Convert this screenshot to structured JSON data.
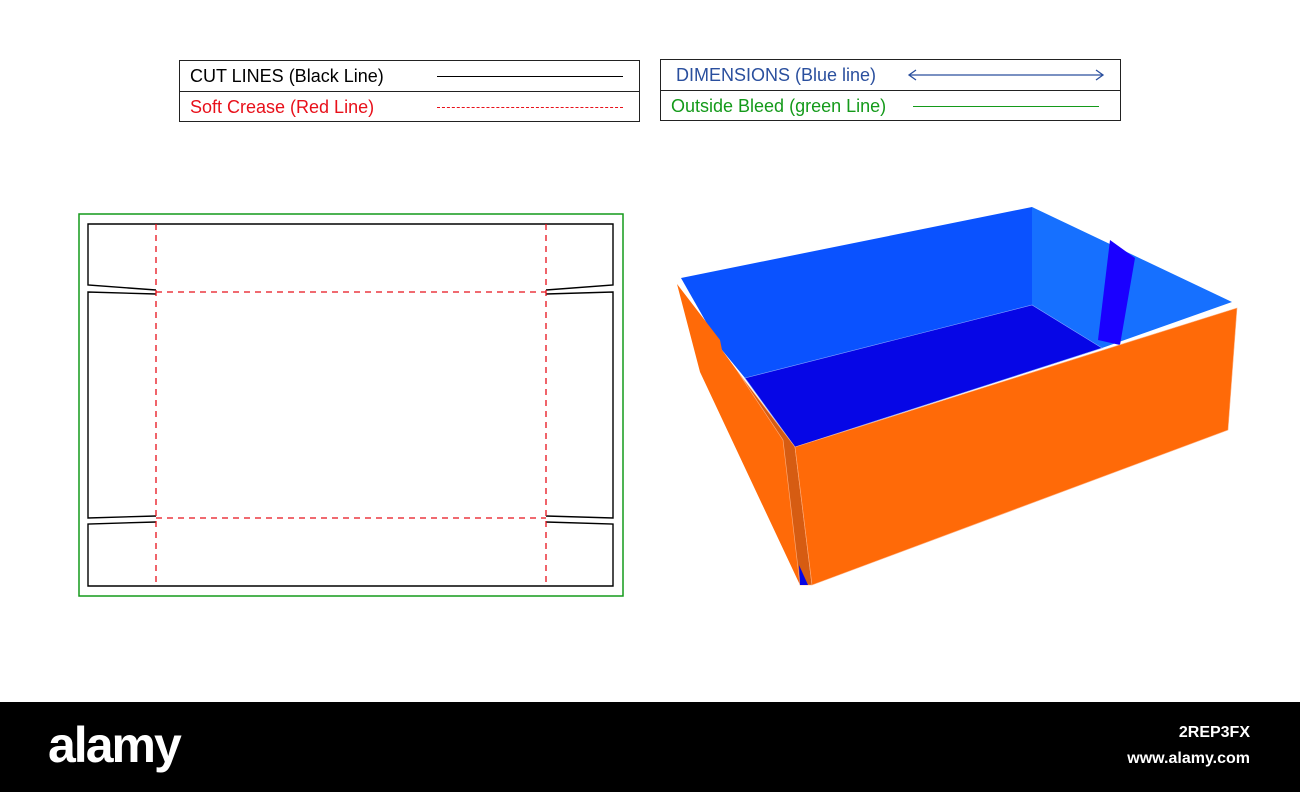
{
  "legend": {
    "cut_lines": {
      "label": "CUT LINES (Black Line)",
      "color": "#000000"
    },
    "soft_crease": {
      "label": "Soft Crease (Red Line)",
      "color": "#e8101a"
    },
    "dimensions": {
      "label": "DIMENSIONS (Blue line)",
      "color": "#2a4f9e"
    },
    "outside_bleed": {
      "label": "Outside Bleed (green Line)",
      "color": "#149a1a"
    }
  },
  "box_colors": {
    "outer": "#ff6a08",
    "outer_flap": "#d65c12",
    "inner_back": "#0a52ff",
    "inner_side": "#1670ff",
    "floor": "#0606e6"
  },
  "footer": {
    "logo": "alamy",
    "image_id": "2REP3FX",
    "site": "www.alamy.com"
  }
}
